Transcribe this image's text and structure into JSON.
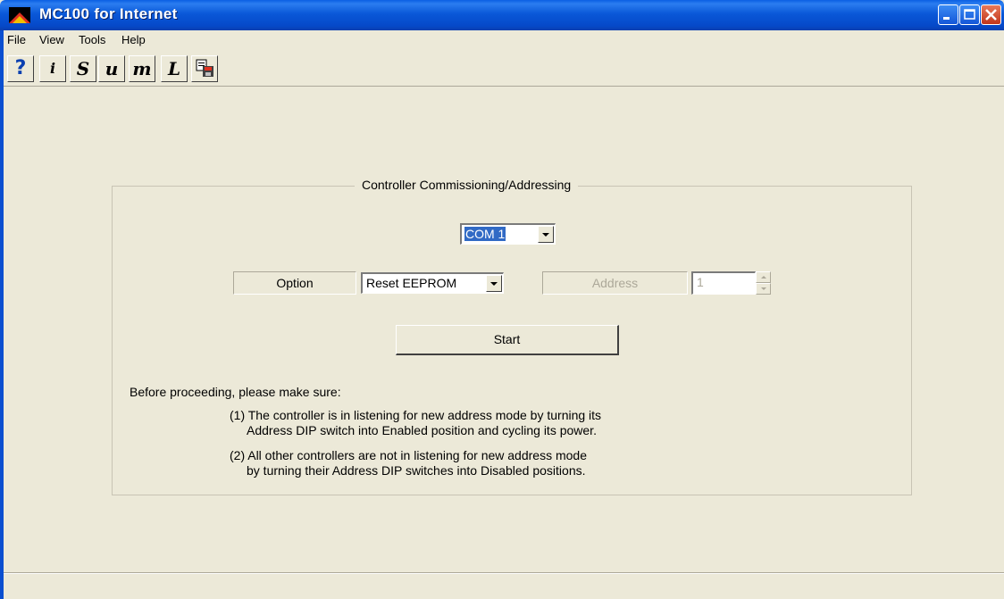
{
  "window": {
    "title": "MC100 for Internet"
  },
  "menu": [
    "File",
    "View",
    "Tools",
    "Help"
  ],
  "toolbar": {
    "buttons": [
      {
        "icon": "help-icon",
        "glyph": "?"
      },
      {
        "icon": "info-icon",
        "glyph": "i"
      },
      {
        "icon": "s-icon",
        "glyph": "S"
      },
      {
        "icon": "u-icon",
        "glyph": "u"
      },
      {
        "icon": "m-icon",
        "glyph": "m"
      },
      {
        "icon": "l-icon",
        "glyph": "L"
      },
      {
        "icon": "save-copy-icon",
        "glyph": ""
      }
    ]
  },
  "group": {
    "title": "Controller Commissioning/Addressing",
    "port": "COM 1",
    "option_label": "Option",
    "option_value": "Reset EEPROM",
    "address_label": "Address",
    "address_value": "1",
    "start_label": "Start",
    "note_intro": "Before proceeding, please make sure:",
    "note1_line1": "(1) The controller is in listening for new address mode by turning its",
    "note1_line2": "Address DIP switch into Enabled position and cycling its power.",
    "note2_line1": "(2) All other controllers are not in listening for new address mode",
    "note2_line2": "by turning their Address DIP switches into Disabled positions."
  },
  "colors": {
    "titlebar": "#0a58d8",
    "face": "#ece9d8",
    "selection": "#316ac5",
    "close_button": "#c2361a"
  }
}
